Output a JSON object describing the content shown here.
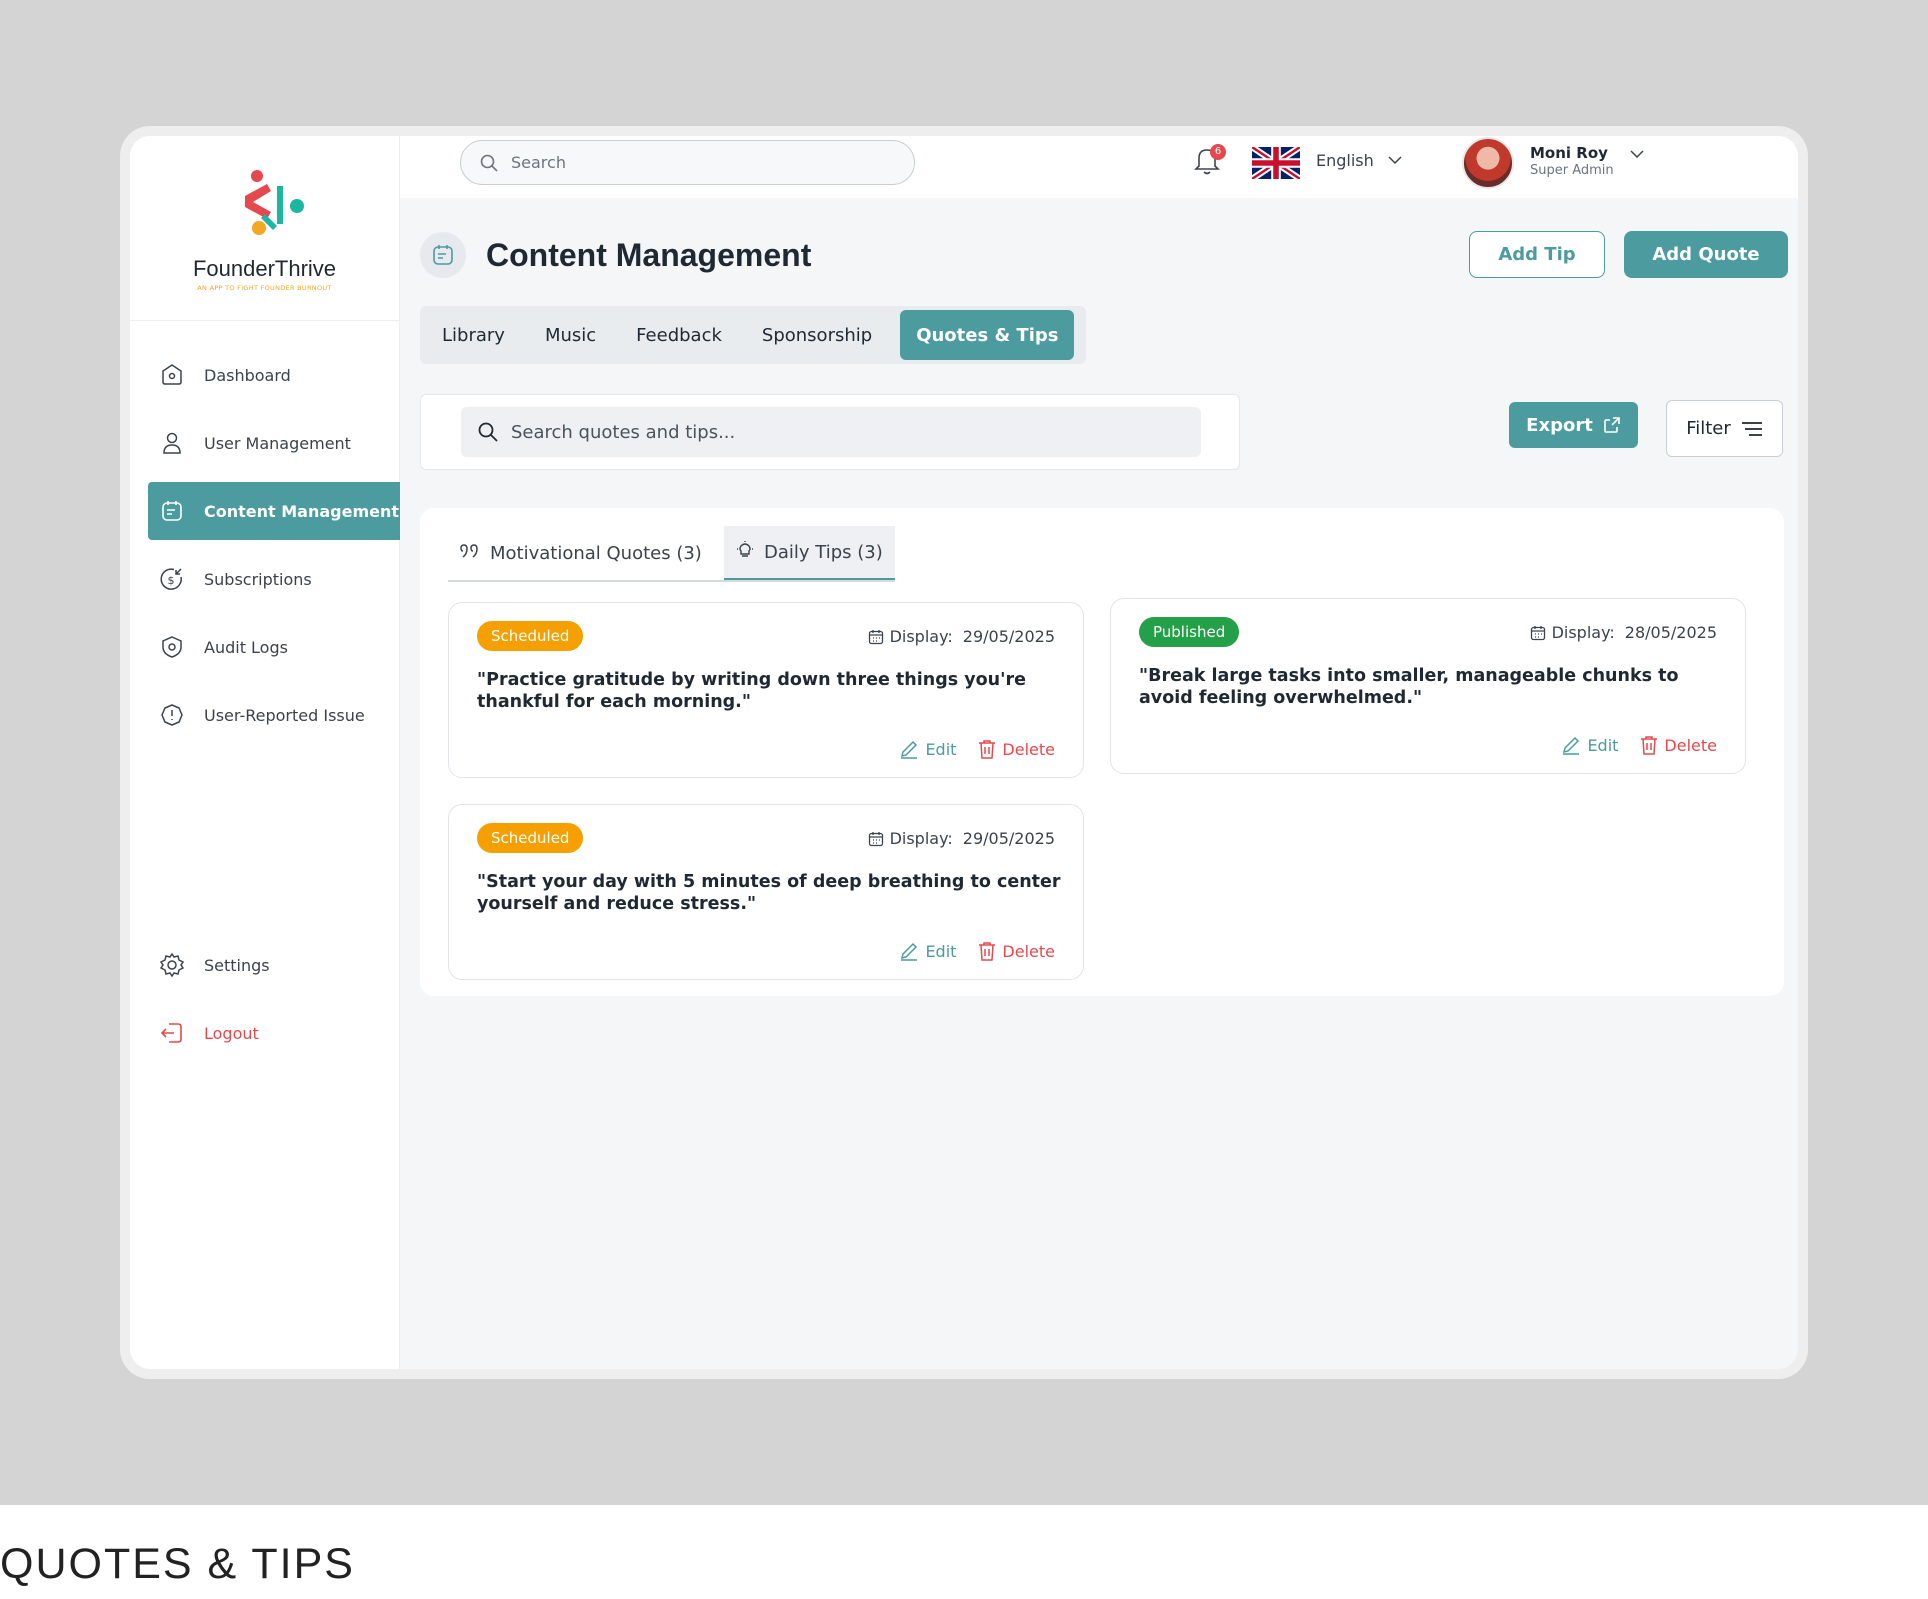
{
  "brand": {
    "name": "FounderThrive",
    "tagline": "AN APP TO FIGHT FOUNDER BURNOUT"
  },
  "sidebar": {
    "items": [
      {
        "label": "Dashboard",
        "icon": "home-icon"
      },
      {
        "label": "User  Management",
        "icon": "user-icon"
      },
      {
        "label": "Content Management",
        "icon": "content-icon",
        "active": true
      },
      {
        "label": "Subscriptions",
        "icon": "dollar-icon"
      },
      {
        "label": "Audit Logs",
        "icon": "shield-icon"
      },
      {
        "label": "User-Reported Issue",
        "icon": "alert-icon"
      }
    ],
    "settings": "Settings",
    "logout": "Logout"
  },
  "topbar": {
    "search_placeholder": "Search",
    "notifications_count": "6",
    "language": "English",
    "user": {
      "name": "Moni Roy",
      "role": "Super Admin"
    }
  },
  "page": {
    "title": "Content Management",
    "add_tip": "Add Tip",
    "add_quote": "Add Quote"
  },
  "tabs": [
    "Library",
    "Music",
    "Feedback",
    "Sponsorship",
    "Quotes & Tips"
  ],
  "active_tab": "Quotes & Tips",
  "search": {
    "placeholder": "Search quotes and tips..."
  },
  "export_label": "Export",
  "filter_label": "Filter",
  "subtabs": {
    "quotes": "Motivational Quotes (3)",
    "tips": "Daily Tips (3)"
  },
  "tips": [
    {
      "status": "Scheduled",
      "display_label": "Display:",
      "date": "29/05/2025",
      "text": "\"Practice gratitude by writing down three things you're thankful for each morning.\"",
      "edit": "Edit",
      "delete": "Delete"
    },
    {
      "status": "Published",
      "display_label": "Display:",
      "date": "28/05/2025",
      "text": "\"Break large tasks into smaller, manageable chunks to avoid feeling overwhelmed.\"",
      "edit": "Edit",
      "delete": "Delete"
    },
    {
      "status": "Scheduled",
      "display_label": "Display:",
      "date": "29/05/2025",
      "text": "\"Start your day with 5 minutes of deep breathing to center yourself and reduce stress.\"",
      "edit": "Edit",
      "delete": "Delete"
    }
  ],
  "caption": "QUOTES & TIPS",
  "colors": {
    "accent": "#4b9b9f",
    "scheduled": "#f5a000",
    "published": "#24a148",
    "danger": "#e5484d"
  }
}
